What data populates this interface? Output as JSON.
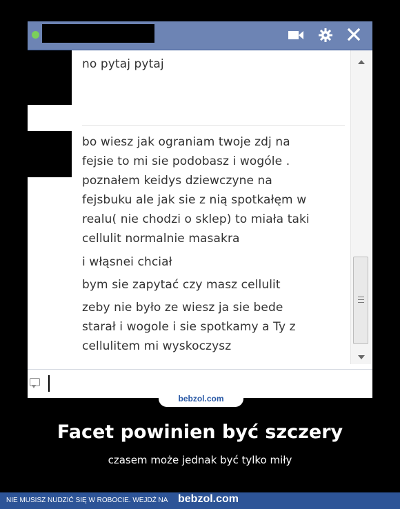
{
  "chat": {
    "icons": [
      "video-camera-icon",
      "gear-icon",
      "close-icon"
    ],
    "messages": [
      {
        "lines": [
          "no pytaj pytaj"
        ]
      },
      {
        "lines": [
          "bo wiesz jak ograniam twoje zdj na",
          "fejsie to mi sie podobasz i wogóle .",
          "poznałem keidys dziewczyne na",
          "fejsbuku ale jak sie z nią spotkałęm w",
          "realu( nie chodzi o sklep) to miała taki",
          "cellulit normalnie masakra",
          "i włąsnei chciał",
          "bym sie zapytać czy masz cellulit",
          "zeby nie było ze wiesz ja sie bede",
          "starał i wogole i sie spotkamy a Ty z",
          "cellulitem mi wyskoczysz"
        ]
      }
    ]
  },
  "watermark": {
    "tab": "bebzol.com"
  },
  "poster": {
    "title": "Facet powinien być szczery",
    "subtitle": "czasem może jednak być tylko miły"
  },
  "footer": {
    "text": "NIE MUSISZ NUDZIĆ SIĘ W ROBOCIE. WEJDŹ NA",
    "brand": "bebzol.com"
  },
  "colors": {
    "titlebar": "#6d84b4",
    "footer": "#2d5497",
    "background": "#000000"
  }
}
